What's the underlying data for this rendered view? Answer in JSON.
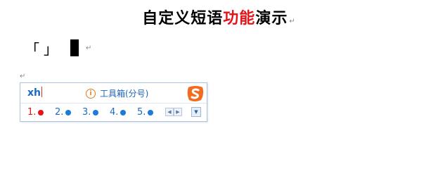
{
  "document": {
    "title_part1": "自定义短语",
    "title_highlight": "功能",
    "title_part2": "演示",
    "paragraph_mark": "↵",
    "sample_left_corner": "「",
    "sample_right_corner": "」"
  },
  "ime": {
    "pinyin_input": "xh",
    "toolbox_hint": "工具箱(分号)",
    "info_icon": "info-icon",
    "logo": "sogou-logo",
    "candidates": [
      {
        "index": "1.",
        "highlighted": true
      },
      {
        "index": "2.",
        "highlighted": false
      },
      {
        "index": "3.",
        "highlighted": false
      },
      {
        "index": "4.",
        "highlighted": false
      },
      {
        "index": "5.",
        "highlighted": false
      }
    ],
    "pager_prev_icon": "◀",
    "pager_next_icon": "▶",
    "menu_icon": "▼"
  },
  "colors": {
    "highlight_red": "#e3141b",
    "ime_blue": "#1c6bc7",
    "logo_orange": "#f26c1f"
  }
}
